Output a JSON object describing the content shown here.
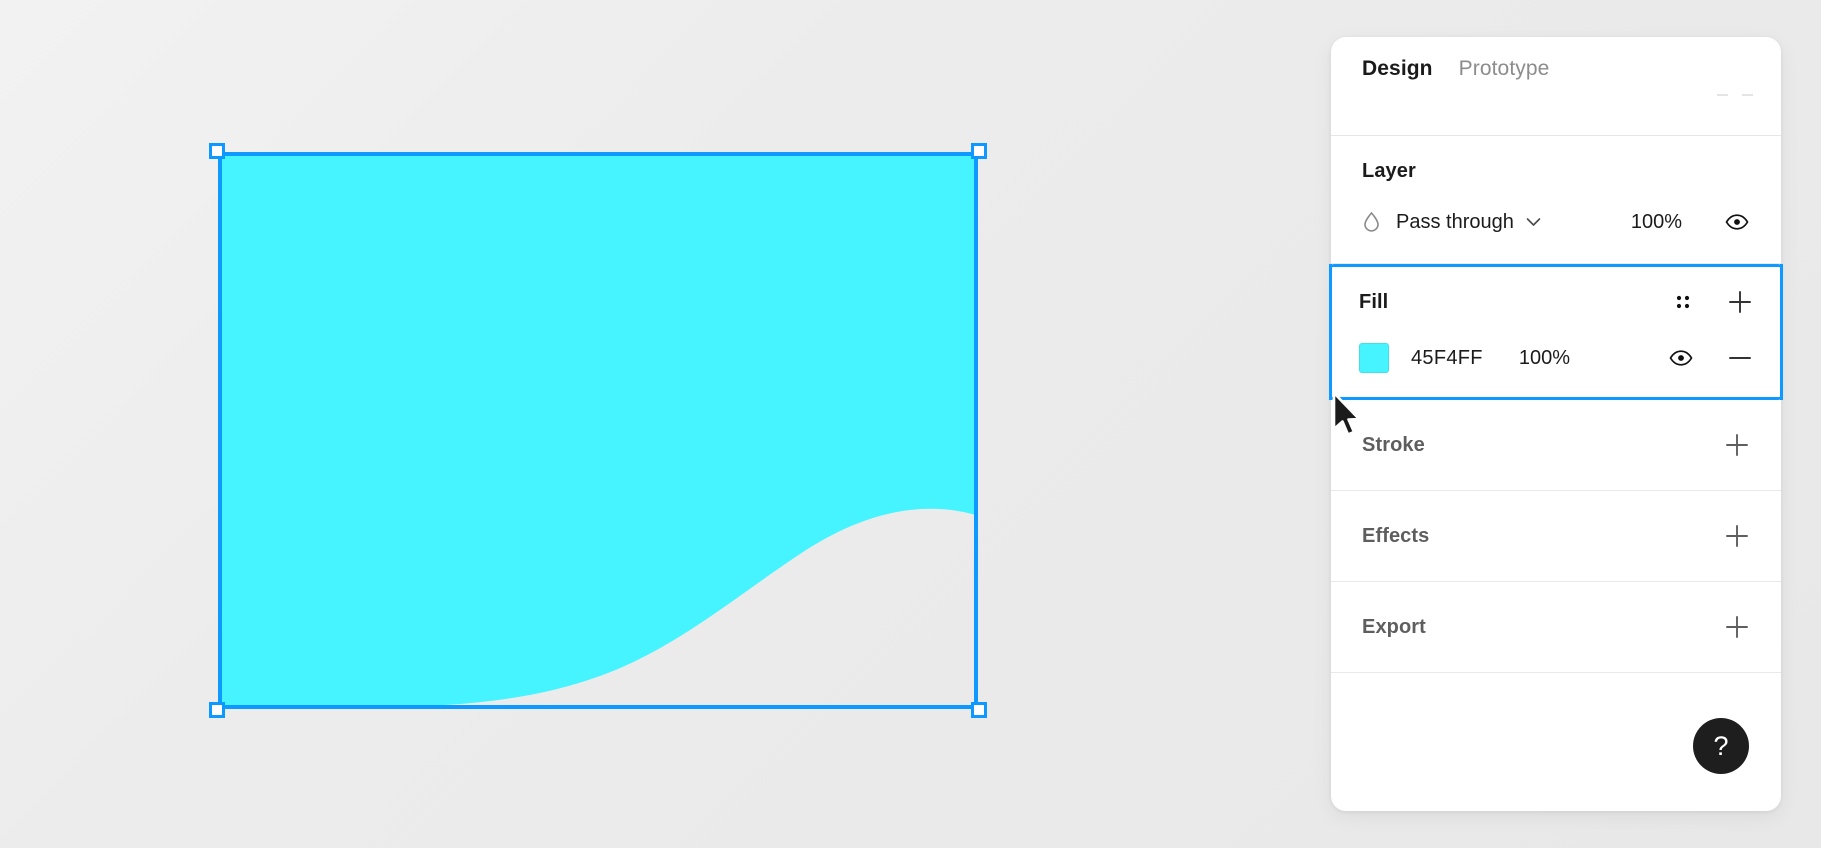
{
  "panel": {
    "tabs": [
      {
        "label": "Design",
        "active": true
      },
      {
        "label": "Prototype",
        "active": false
      }
    ],
    "layer": {
      "title": "Layer",
      "blend_mode": "Pass through",
      "blend_mode_icon": "droplet-icon",
      "opacity": "100%",
      "visibility_icon": "eye-icon",
      "chevron_icon": "chevron-down-icon"
    },
    "fill": {
      "title": "Fill",
      "selected": true,
      "styles_icon": "four-dots-icon",
      "add_icon": "plus-icon",
      "swatch_color": "#45F4FF",
      "hex": "45F4FF",
      "opacity": "100%",
      "visibility_icon": "eye-icon",
      "remove_icon": "minus-icon"
    },
    "stroke": {
      "title": "Stroke",
      "add_icon": "plus-icon"
    },
    "effects": {
      "title": "Effects",
      "add_icon": "plus-icon"
    },
    "export": {
      "title": "Export",
      "add_icon": "plus-icon"
    },
    "help": {
      "label": "?",
      "icon": "question-mark-icon"
    }
  },
  "canvas": {
    "shape_name": "wave-shape",
    "shape_fill": "#45F4FF",
    "selection_color": "#0D99FF",
    "background": "#ECECEC",
    "cursor_icon": "arrow-cursor"
  }
}
